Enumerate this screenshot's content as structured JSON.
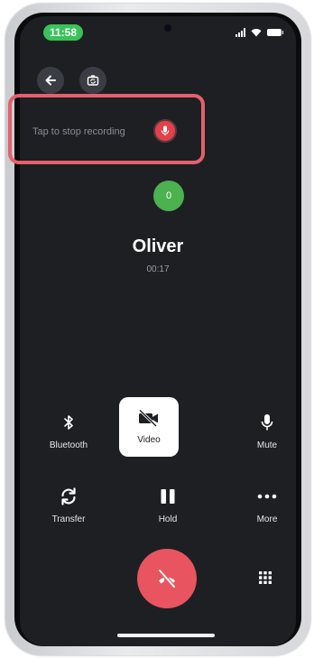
{
  "status_bar": {
    "time": "11:58"
  },
  "top_bar": {
    "back_icon": "arrow-left-icon",
    "flip_icon": "camera-flip-icon"
  },
  "recording": {
    "label": "Tap to stop recording",
    "icon": "microphone-icon",
    "button_color": "#e5404a",
    "highlight_color": "#e4606d"
  },
  "contact": {
    "avatar_initial": "0",
    "avatar_color": "#4cb14f",
    "name": "Oliver",
    "timer": "00:17"
  },
  "controls": {
    "bluetooth": {
      "label": "Bluetooth",
      "icon": "bluetooth-icon"
    },
    "video": {
      "label": "Video",
      "icon": "video-off-icon"
    },
    "mute": {
      "label": "Mute",
      "icon": "microphone-icon"
    },
    "transfer": {
      "label": "Transfer",
      "icon": "transfer-icon"
    },
    "hold": {
      "label": "Hold",
      "icon": "pause-icon"
    },
    "more": {
      "label": "More",
      "icon": "more-dots-icon"
    }
  },
  "end_call": {
    "icon": "end-call-icon",
    "color": "#e8545f"
  },
  "keypad": {
    "icon": "keypad-icon"
  }
}
